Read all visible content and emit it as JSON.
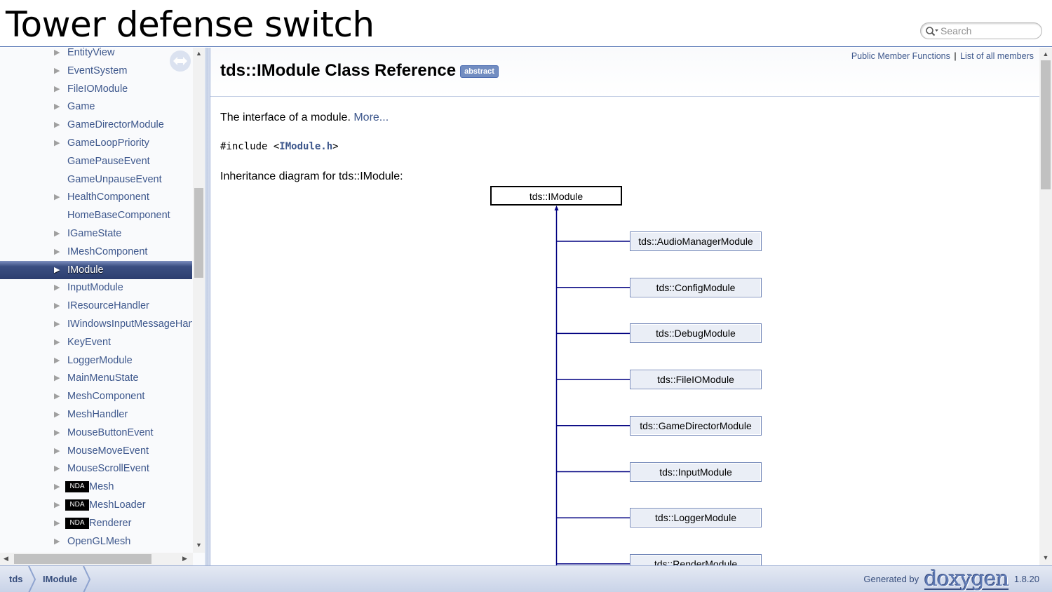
{
  "project": {
    "name": "Tower defense switch"
  },
  "search": {
    "placeholder": "Search"
  },
  "sidebar": {
    "items": [
      {
        "label": "EntityView",
        "arrow": "▶"
      },
      {
        "label": "EventSystem",
        "arrow": "▶"
      },
      {
        "label": "FileIOModule",
        "arrow": "▶"
      },
      {
        "label": "Game",
        "arrow": "▶"
      },
      {
        "label": "GameDirectorModule",
        "arrow": "▶"
      },
      {
        "label": "GameLoopPriority",
        "arrow": "▶"
      },
      {
        "label": "GamePauseEvent",
        "arrow": ""
      },
      {
        "label": "GameUnpauseEvent",
        "arrow": ""
      },
      {
        "label": "HealthComponent",
        "arrow": "▶"
      },
      {
        "label": "HomeBaseComponent",
        "arrow": ""
      },
      {
        "label": "IGameState",
        "arrow": "▶"
      },
      {
        "label": "IMeshComponent",
        "arrow": "▶"
      },
      {
        "label": "IModule",
        "arrow": "▶"
      },
      {
        "label": "InputModule",
        "arrow": "▶"
      },
      {
        "label": "IResourceHandler",
        "arrow": "▶"
      },
      {
        "label": "IWindowsInputMessageHandler",
        "arrow": "▶"
      },
      {
        "label": "KeyEvent",
        "arrow": "▶"
      },
      {
        "label": "LoggerModule",
        "arrow": "▶"
      },
      {
        "label": "MainMenuState",
        "arrow": "▶"
      },
      {
        "label": "MeshComponent",
        "arrow": "▶"
      },
      {
        "label": "MeshHandler",
        "arrow": "▶"
      },
      {
        "label": "MouseButtonEvent",
        "arrow": "▶"
      },
      {
        "label": "MouseMoveEvent",
        "arrow": "▶"
      },
      {
        "label": "MouseScrollEvent",
        "arrow": "▶"
      },
      {
        "label": "Mesh",
        "arrow": "▶",
        "badge": "NDA"
      },
      {
        "label": "MeshLoader",
        "arrow": "▶",
        "badge": "NDA"
      },
      {
        "label": "Renderer",
        "arrow": "▶",
        "badge": "NDA"
      },
      {
        "label": "OpenGLMesh",
        "arrow": "▶"
      }
    ],
    "selected_index": 12
  },
  "header": {
    "summary_links": [
      "Public Member Functions",
      "List of all members"
    ],
    "summary_separator": "|",
    "title": "tds::IModule Class Reference",
    "badge": "abstract"
  },
  "content": {
    "brief": "The interface of a module.",
    "more_link": "More...",
    "include_prefix": "#include <",
    "include_file": "IModule.h",
    "include_suffix": ">",
    "inheritance_title": "Inheritance diagram for tds::IModule:"
  },
  "diagram": {
    "root": "tds::IModule",
    "children": [
      "tds::AudioManagerModule",
      "tds::ConfigModule",
      "tds::DebugModule",
      "tds::FileIOModule",
      "tds::GameDirectorModule",
      "tds::InputModule",
      "tds::LoggerModule",
      "tds::RenderModule"
    ],
    "line_color": "#000080"
  },
  "breadcrumbs": [
    "tds",
    "IModule"
  ],
  "footer": {
    "generated_by": "Generated by",
    "logo_text": "doxygen",
    "version": "1.8.20"
  },
  "colors": {
    "link": "#3D578C",
    "selected": "#3b4f82"
  }
}
